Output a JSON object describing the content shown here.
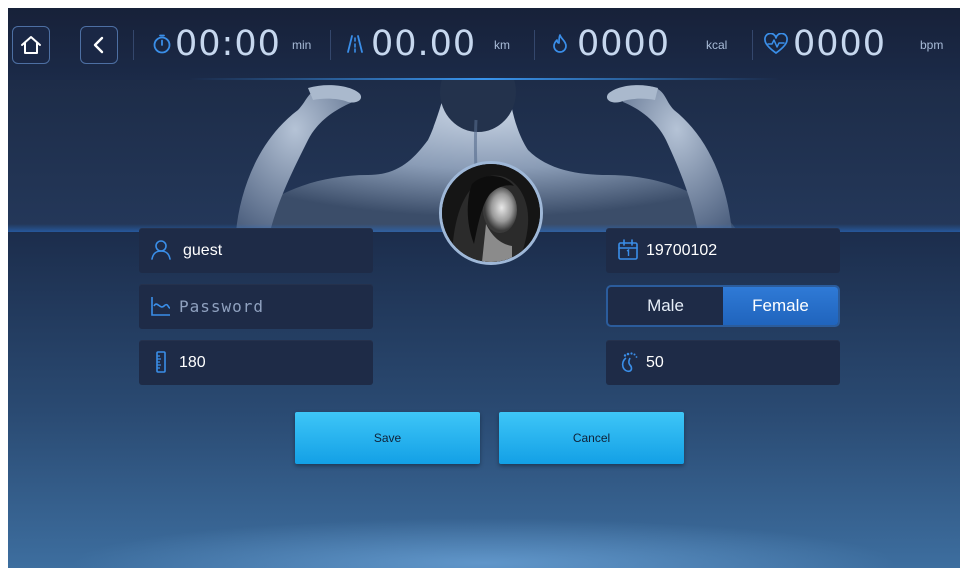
{
  "topbar": {
    "home_icon": "home-icon",
    "back_icon": "chevron-left-icon",
    "time": {
      "icon": "stopwatch-icon",
      "value": "00:00",
      "unit": "min"
    },
    "distance": {
      "icon": "road-icon",
      "value": "00.00",
      "unit": "km"
    },
    "calories": {
      "icon": "flame-icon",
      "value": "0000",
      "unit": "kcal"
    },
    "heart": {
      "icon": "heart-rate-icon",
      "value": "0000",
      "unit": "bpm"
    }
  },
  "form": {
    "username": {
      "icon": "user-icon",
      "value": "guest"
    },
    "password": {
      "icon": "password-chart-icon",
      "placeholder": "Password",
      "value": ""
    },
    "height": {
      "icon": "ruler-icon",
      "value": "180"
    },
    "birthday": {
      "icon": "calendar-icon",
      "value": "19700102"
    },
    "gender": {
      "options": [
        "Male",
        "Female"
      ],
      "selected": "Female"
    },
    "weight": {
      "icon": "foot-icon",
      "value": "50"
    }
  },
  "actions": {
    "save_label": "Save",
    "cancel_label": "Cancel"
  },
  "colors": {
    "accent": "#1aa7ea",
    "toggle_selected": "#2a6fca",
    "field_bg": "#1e2b47",
    "topbar_bg": "#172139"
  }
}
